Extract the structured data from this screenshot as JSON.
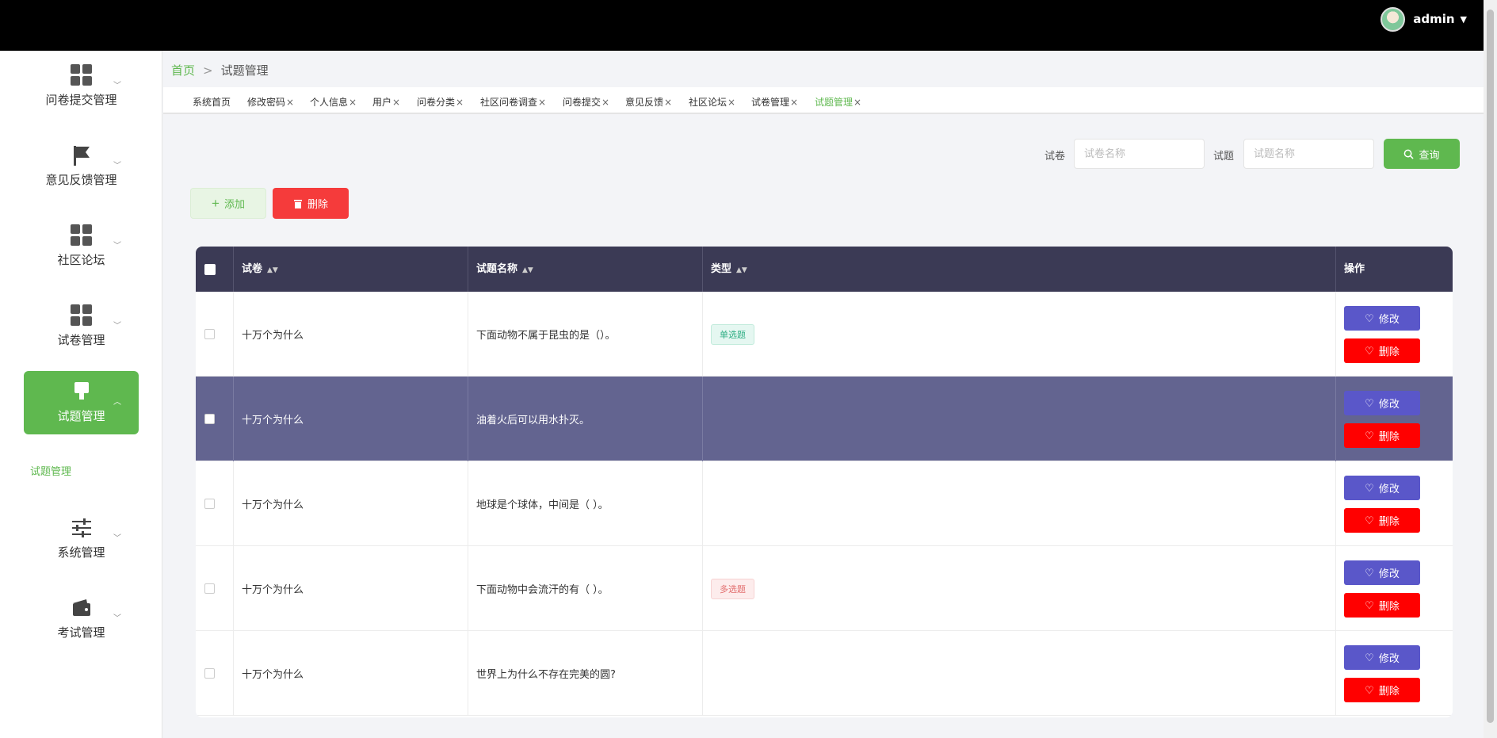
{
  "header": {
    "username": "admin"
  },
  "sidebar": {
    "items": [
      {
        "label": "问卷提交管理",
        "icon": "grid-icon"
      },
      {
        "label": "意见反馈管理",
        "icon": "flag-icon"
      },
      {
        "label": "社区论坛",
        "icon": "grid-icon"
      },
      {
        "label": "试卷管理",
        "icon": "grid-icon"
      },
      {
        "label": "试题管理",
        "icon": "paint-brush-icon",
        "active": true
      },
      {
        "label": "系统管理",
        "icon": "sliders-icon"
      },
      {
        "label": "考试管理",
        "icon": "wallet-icon"
      }
    ],
    "sub_item": "试题管理"
  },
  "breadcrumb": {
    "home": "首页",
    "sep": ">",
    "current": "试题管理"
  },
  "tabs": [
    "系统首页",
    "修改密码",
    "个人信息",
    "用户",
    "问卷分类",
    "社区问卷调查",
    "问卷提交",
    "意见反馈",
    "社区论坛",
    "试卷管理",
    "试题管理"
  ],
  "tab_close": "×",
  "search": {
    "paper_label": "试卷",
    "paper_placeholder": "试卷名称",
    "question_label": "试题",
    "question_placeholder": "试题名称",
    "query_label": "查询"
  },
  "actions": {
    "add_label": "添加",
    "delete_label": "删除"
  },
  "table": {
    "headers": {
      "paper": "试卷",
      "name": "试题名称",
      "type": "类型",
      "ops": "操作"
    },
    "rows": [
      {
        "paper": "十万个为什么",
        "name": "下面动物不属于昆虫的是（）。",
        "type": "单选题",
        "type_kind": "single"
      },
      {
        "paper": "十万个为什么",
        "name": "油着火后可以用水扑灭。",
        "type": "",
        "type_kind": ""
      },
      {
        "paper": "十万个为什么",
        "name": "地球是个球体，中间是（ ）。",
        "type": "",
        "type_kind": ""
      },
      {
        "paper": "十万个为什么",
        "name": "下面动物中会流汗的有（ ）。",
        "type": "多选题",
        "type_kind": "multi"
      },
      {
        "paper": "十万个为什么",
        "name": "世界上为什么不存在完美的圆?",
        "type": "",
        "type_kind": ""
      }
    ],
    "edit_label": "修改",
    "remove_label": "删除"
  }
}
